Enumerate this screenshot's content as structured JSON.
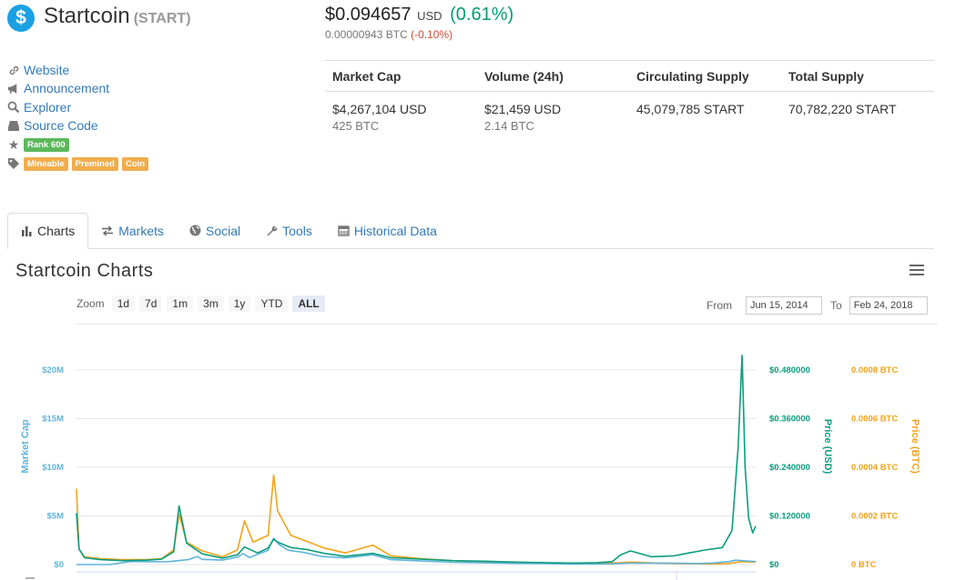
{
  "coin": {
    "name": "Startcoin",
    "symbol": "(START)",
    "logo_glyph": "$"
  },
  "price": {
    "usd": "$0.094657",
    "usd_unit": "USD",
    "usd_change": "(0.61%)",
    "btc": "0.00000943 BTC",
    "btc_change": "(-0.10%)"
  },
  "links": [
    {
      "icon": "link-icon",
      "label": "Website"
    },
    {
      "icon": "bullhorn-icon",
      "label": "Announcement"
    },
    {
      "icon": "search-icon",
      "label": "Explorer"
    },
    {
      "icon": "hdd-icon",
      "label": "Source Code"
    }
  ],
  "rank_badge": "Rank 600",
  "tags": [
    "Mineable",
    "Premined",
    "Coin"
  ],
  "stats": {
    "headers": [
      "Market Cap",
      "Volume (24h)",
      "Circulating Supply",
      "Total Supply"
    ],
    "market_cap_usd": "$4,267,104 USD",
    "market_cap_btc": "425 BTC",
    "volume_usd": "$21,459 USD",
    "volume_btc": "2.14 BTC",
    "circulating": "45,079,785 START",
    "total": "70,782,220 START"
  },
  "tabs": [
    {
      "icon": "bar-chart-icon",
      "label": "Charts",
      "active": true
    },
    {
      "icon": "exchange-icon",
      "label": "Markets"
    },
    {
      "icon": "globe-icon",
      "label": "Social"
    },
    {
      "icon": "wrench-icon",
      "label": "Tools"
    },
    {
      "icon": "calendar-icon",
      "label": "Historical Data"
    }
  ],
  "chart_header": {
    "title": "Startcoin Charts",
    "zoom_label": "Zoom",
    "zoom_buttons": [
      "1d",
      "7d",
      "1m",
      "3m",
      "1y",
      "YTD",
      "ALL"
    ],
    "zoom_selected": "ALL",
    "from_label": "From",
    "from_value": "Jun 15, 2014",
    "to_label": "To",
    "to_value": "Feb 24, 2018"
  },
  "colors": {
    "market_cap": "#5fb4dd",
    "price_usd": "#0b9d7e",
    "price_btc": "#f2a31a",
    "link": "#337ab7"
  },
  "chart_data": {
    "type": "line",
    "x_range": [
      "2014-06-15",
      "2018-02-24"
    ],
    "axes": {
      "left": {
        "label": "Market Cap",
        "ticks": [
          "$0",
          "$5M",
          "$10M",
          "$15M",
          "$20M"
        ],
        "range": [
          0,
          20000000
        ]
      },
      "right_usd": {
        "label": "Price (USD)",
        "ticks": [
          "$0",
          "$0.120000",
          "$0.240000",
          "$0.360000",
          "$0.480000"
        ],
        "range": [
          0,
          0.48
        ]
      },
      "right_btc": {
        "label": "Price (BTC)",
        "ticks": [
          "0 BTC",
          "0.0002 BTC",
          "0.0004 BTC",
          "0.0006 BTC",
          "0.0008 BTC"
        ],
        "range": [
          0,
          0.0008
        ]
      }
    },
    "grid": true,
    "series": [
      {
        "name": "Market Cap",
        "axis": "left",
        "points": [
          [
            "2014-06-15",
            0
          ],
          [
            "2014-06-25",
            0
          ],
          [
            "2014-07-05",
            0
          ],
          [
            "2014-08-20",
            0
          ],
          [
            "2014-10-01",
            320000
          ],
          [
            "2014-11-01",
            290000
          ],
          [
            "2014-12-15",
            300000
          ],
          [
            "2015-01-25",
            520000
          ],
          [
            "2015-02-10",
            830000
          ],
          [
            "2015-02-20",
            530000
          ],
          [
            "2015-04-01",
            460000
          ],
          [
            "2015-05-01",
            760000
          ],
          [
            "2015-05-12",
            1120000
          ],
          [
            "2015-05-25",
            720000
          ],
          [
            "2015-07-01",
            1480000
          ],
          [
            "2015-07-12",
            2700000
          ],
          [
            "2015-07-22",
            2080000
          ],
          [
            "2015-08-10",
            1480000
          ],
          [
            "2015-09-10",
            1240000
          ],
          [
            "2015-10-15",
            830000
          ],
          [
            "2015-12-01",
            680000
          ],
          [
            "2016-01-25",
            1000000
          ],
          [
            "2016-03-01",
            500000
          ],
          [
            "2016-05-01",
            360000
          ],
          [
            "2016-07-01",
            230000
          ],
          [
            "2016-09-01",
            180000
          ],
          [
            "2016-11-01",
            120000
          ],
          [
            "2017-01-01",
            110000
          ],
          [
            "2017-02-15",
            60000
          ],
          [
            "2017-04-15",
            50000
          ],
          [
            "2017-05-15",
            70000
          ],
          [
            "2017-06-15",
            140000
          ],
          [
            "2017-09-01",
            150000
          ],
          [
            "2017-11-01",
            100000
          ],
          [
            "2017-12-01",
            160000
          ],
          [
            "2018-01-01",
            300000
          ],
          [
            "2018-01-15",
            450000
          ],
          [
            "2018-02-24",
            300000
          ]
        ]
      },
      {
        "name": "Price (USD)",
        "axis": "right_usd",
        "points": [
          [
            "2014-06-15",
            0.127
          ],
          [
            "2014-06-20",
            0.0384
          ],
          [
            "2014-07-01",
            0.0168
          ],
          [
            "2014-08-01",
            0.012
          ],
          [
            "2014-09-15",
            0.0096
          ],
          [
            "2014-11-01",
            0.0108
          ],
          [
            "2014-12-01",
            0.0132
          ],
          [
            "2014-12-25",
            0.0312
          ],
          [
            "2015-01-05",
            0.145
          ],
          [
            "2015-01-20",
            0.0528
          ],
          [
            "2015-02-20",
            0.0264
          ],
          [
            "2015-04-01",
            0.0156
          ],
          [
            "2015-05-01",
            0.024
          ],
          [
            "2015-05-15",
            0.0432
          ],
          [
            "2015-06-10",
            0.0288
          ],
          [
            "2015-07-01",
            0.0408
          ],
          [
            "2015-07-12",
            0.0624
          ],
          [
            "2015-07-20",
            0.0552
          ],
          [
            "2015-08-15",
            0.042
          ],
          [
            "2015-09-15",
            0.0372
          ],
          [
            "2015-10-20",
            0.0276
          ],
          [
            "2015-12-01",
            0.0204
          ],
          [
            "2016-01-25",
            0.0276
          ],
          [
            "2016-03-01",
            0.0168
          ],
          [
            "2016-05-01",
            0.0132
          ],
          [
            "2016-07-01",
            0.0096
          ],
          [
            "2016-09-01",
            0.0084
          ],
          [
            "2016-11-01",
            0.006
          ],
          [
            "2017-01-01",
            0.0048
          ],
          [
            "2017-03-01",
            0.0036
          ],
          [
            "2017-04-15",
            0.0048
          ],
          [
            "2017-05-15",
            0.0072
          ],
          [
            "2017-06-01",
            0.024
          ],
          [
            "2017-06-20",
            0.0336
          ],
          [
            "2017-08-01",
            0.0192
          ],
          [
            "2017-09-15",
            0.0216
          ],
          [
            "2017-10-15",
            0.0288
          ],
          [
            "2017-11-15",
            0.036
          ],
          [
            "2017-12-20",
            0.042
          ],
          [
            "2018-01-08",
            0.084
          ],
          [
            "2018-01-20",
            0.288
          ],
          [
            "2018-01-28",
            0.516
          ],
          [
            "2018-02-03",
            0.24
          ],
          [
            "2018-02-10",
            0.114
          ],
          [
            "2018-02-18",
            0.078
          ],
          [
            "2018-02-24",
            0.0947
          ]
        ]
      },
      {
        "name": "Price (BTC)",
        "axis": "right_btc",
        "points": [
          [
            "2014-06-15",
            0.000312
          ],
          [
            "2014-06-20",
            6.4e-05
          ],
          [
            "2014-07-01",
            3.2e-05
          ],
          [
            "2014-08-01",
            2.4e-05
          ],
          [
            "2014-09-15",
            2e-05
          ],
          [
            "2014-11-01",
            2e-05
          ],
          [
            "2014-12-01",
            2.4e-05
          ],
          [
            "2014-12-25",
            6e-05
          ],
          [
            "2015-01-05",
            0.000208
          ],
          [
            "2015-01-20",
            9.2e-05
          ],
          [
            "2015-02-20",
            5.6e-05
          ],
          [
            "2015-04-01",
            3.2e-05
          ],
          [
            "2015-05-01",
            6e-05
          ],
          [
            "2015-05-15",
            0.00018
          ],
          [
            "2015-06-01",
            9.2e-05
          ],
          [
            "2015-07-01",
            0.00012
          ],
          [
            "2015-07-12",
            0.000368
          ],
          [
            "2015-07-20",
            0.00022
          ],
          [
            "2015-08-15",
            0.00012
          ],
          [
            "2015-09-15",
            9.6e-05
          ],
          [
            "2015-10-20",
            6.8e-05
          ],
          [
            "2015-12-01",
            4.8e-05
          ],
          [
            "2016-01-25",
            8e-05
          ],
          [
            "2016-03-01",
            3.6e-05
          ],
          [
            "2016-05-01",
            2.4e-05
          ],
          [
            "2016-07-01",
            1.6e-05
          ],
          [
            "2016-09-01",
            1.2e-05
          ],
          [
            "2016-11-01",
            8e-06
          ],
          [
            "2017-01-01",
            6e-06
          ],
          [
            "2017-04-15",
            4e-06
          ],
          [
            "2017-06-01",
            8e-06
          ],
          [
            "2017-06-20",
            1e-05
          ],
          [
            "2017-09-15",
            4e-06
          ],
          [
            "2017-12-01",
            2e-06
          ],
          [
            "2018-01-01",
            4e-06
          ],
          [
            "2018-01-28",
            1.2e-05
          ],
          [
            "2018-02-24",
            9.4e-06
          ]
        ]
      }
    ]
  }
}
